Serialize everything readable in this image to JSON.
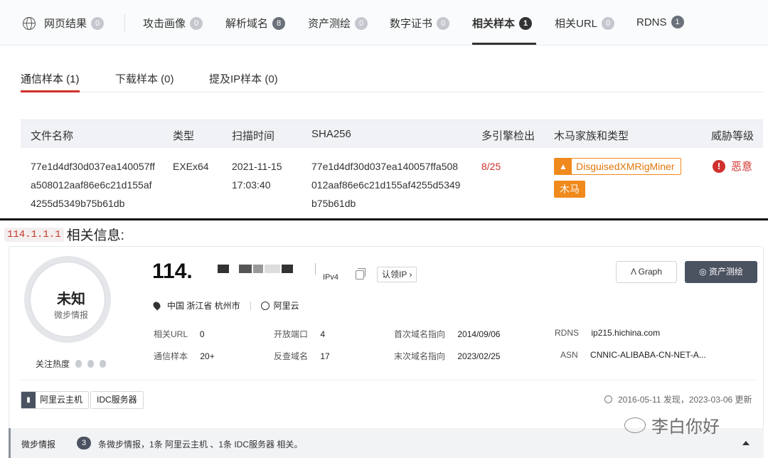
{
  "tabs": [
    {
      "label": "网页结果",
      "count": "0"
    },
    {
      "label": "攻击画像",
      "count": "0"
    },
    {
      "label": "解析域名",
      "count": "8"
    },
    {
      "label": "资产测绘",
      "count": "0"
    },
    {
      "label": "数字证书",
      "count": "0"
    },
    {
      "label": "相关样本",
      "count": "1"
    },
    {
      "label": "相关URL",
      "count": "0"
    },
    {
      "label": "RDNS",
      "count": "1"
    }
  ],
  "subtabs": [
    "通信样本 (1)",
    "下载样本 (0)",
    "提及IP样本 (0)"
  ],
  "table": {
    "headers": [
      "文件名称",
      "类型",
      "扫描时间",
      "SHA256",
      "多引擎检出",
      "木马家族和类型",
      "威胁等级"
    ],
    "row": {
      "filename": [
        "77e1d4df30d037ea140057ff",
        "a508012aaf86e6c21d155af",
        "4255d5349b75b61db"
      ],
      "type": "EXEx64",
      "scan_time": [
        "2021-11-15",
        "17:03:40"
      ],
      "sha256": [
        "77e1d4df30d037ea140057ffa508",
        "012aaf86e6c21d155af4255d5349",
        "b75b61db"
      ],
      "detection": "8/25",
      "family": "DisguisedXMRigMiner",
      "family_type": "木马",
      "threat": "恶意"
    }
  },
  "heading": {
    "ip_code": "114.1.1.1",
    "suffix": "相关信息:"
  },
  "profile": {
    "status": "未知",
    "status_sub": "微步情报",
    "heat_label": "关注热度",
    "ip_prefix": "114.",
    "ip_version": "IPv4",
    "claim_label": "认领IP ›",
    "location": "中国 浙江省 杭州市",
    "isp": "阿里云",
    "graph_label": "Graph",
    "asset_label": "资产测绘",
    "fields": [
      {
        "k": "相关URL",
        "v": "0"
      },
      {
        "k": "开放端口",
        "v": "4"
      },
      {
        "k": "首次域名指向",
        "v": "2014/09/06"
      },
      {
        "k": "RDNS",
        "v": "ip215.hichina.com"
      },
      {
        "k": "通信样本",
        "v": "20+"
      },
      {
        "k": "反查域名",
        "v": "17"
      },
      {
        "k": "末次域名指向",
        "v": "2023/02/25"
      },
      {
        "k": "ASN",
        "v": "CNNIC-ALIBABA-CN-NET-A..."
      }
    ],
    "tag_ali": "阿里云主机",
    "tag_idc": "IDC服务器",
    "dates": "2016-05-11 发现，2023-03-06 更新"
  },
  "intel": {
    "title": "微步情报",
    "count": "3",
    "text": "条微步情报，1条 阿里云主机 、1条 IDC服务器 相关。"
  },
  "watermark": "李白你好"
}
